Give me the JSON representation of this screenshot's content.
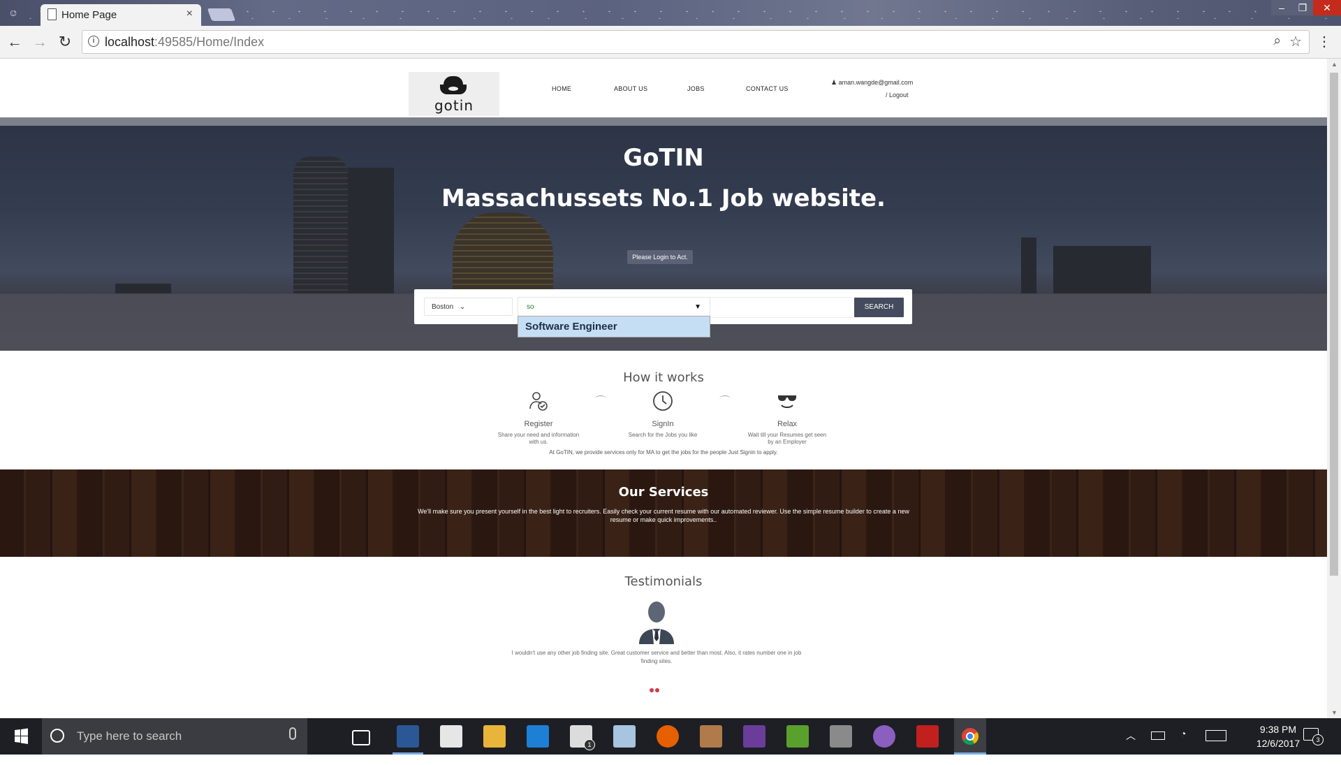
{
  "browser": {
    "tab_title": "Home Page",
    "tab_close": "×",
    "url_host": "localhost",
    "url_rest": ":49585/Home/Index",
    "back": "←",
    "forward": "→",
    "reload": "↻",
    "zoom_icon": "⌕",
    "bookmark_icon": "☆",
    "menu_icon": "⋮",
    "window_minimize": "–",
    "window_restore": "❐",
    "window_close": "✕"
  },
  "site": {
    "logo_text": "gotin",
    "nav": [
      "HOME",
      "ABOUT US",
      "JOBS",
      "CONTACT US"
    ],
    "user_email": "aman.wangde@gmail.com",
    "logout": "/ Logout"
  },
  "hero": {
    "title": "GoTIN",
    "subtitle": "Massachussets No.1 Job website.",
    "login_button": "Please Login to Act."
  },
  "search": {
    "city": "Boston",
    "city_chevron": "⌄",
    "query_value": "so",
    "dropdown_caret": "▼",
    "suggestion": "Software Engineer",
    "button": "SEARCH"
  },
  "how": {
    "title": "How it works",
    "steps": [
      {
        "label": "Register",
        "desc": "Share your need and information with us."
      },
      {
        "label": "SignIn",
        "desc": "Search for the Jobs you like"
      },
      {
        "label": "Relax",
        "desc": "Wait till your Resumes get seen by an Employer"
      }
    ],
    "note": "At GoTIN, we provide services only for MA to get the jobs for the people Just Signin to apply."
  },
  "services": {
    "title": "Our Services",
    "text": "We'll make sure you present yourself in the best light to recruiters. Easily check your current resume with our automated reviewer. Use the simple resume builder to create a new resume or make quick improvements.."
  },
  "testimonials": {
    "title": "Testimonials",
    "quote": "I wouldn't use any other job finding site. Great customer service and better than most. Also, it rates number one in job finding sites."
  },
  "taskbar": {
    "search_placeholder": "Type here to search",
    "mail_badge": "1",
    "time": "9:38 PM",
    "date": "12/6/2017",
    "notification_count": "3"
  },
  "colors": {
    "search_button": "#454b5e",
    "suggestion_bg": "#c6def4",
    "carousel_dot": "#d23a4a"
  }
}
